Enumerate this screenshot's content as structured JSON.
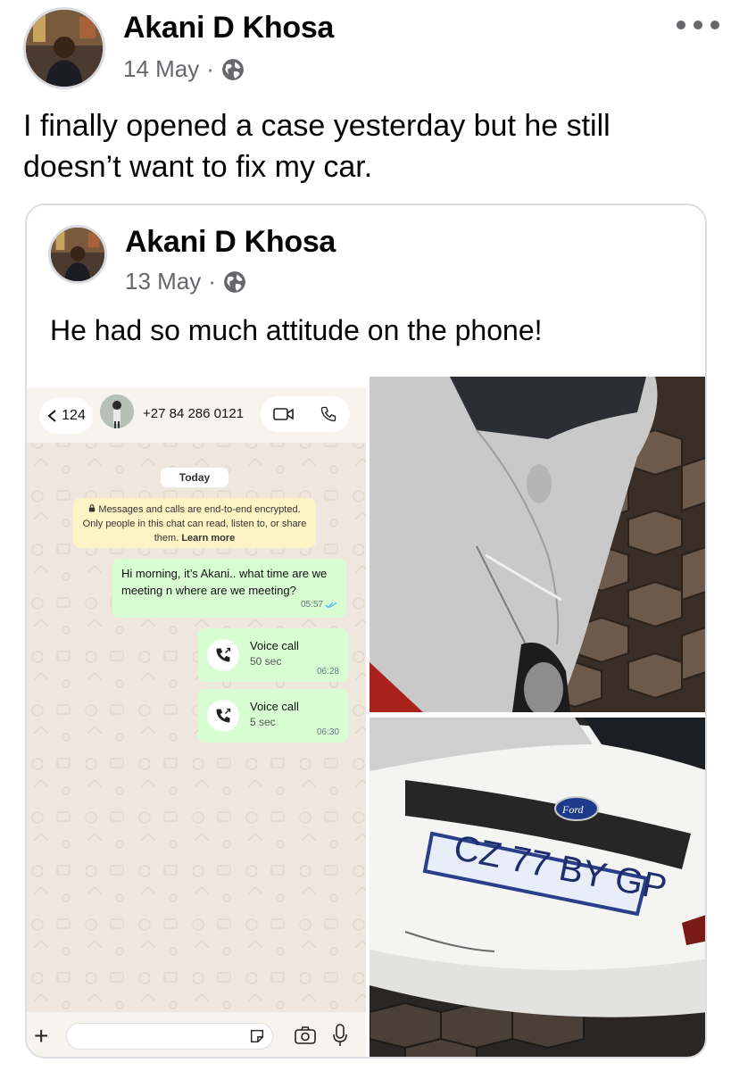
{
  "post": {
    "author": "Akani D Khosa",
    "date": "14 May",
    "separator": "·",
    "text": "I finally opened a case yesterday but he still doesn’t want to fix my car.",
    "privacy_icon": "globe-icon"
  },
  "shared": {
    "author": "Akani D Khosa",
    "date": "13 May",
    "separator": "·",
    "text": "He had so much attitude on the phone!",
    "privacy_icon": "globe-icon"
  },
  "whatsapp": {
    "back_count": "124",
    "contact": "+27 84 286 0121",
    "date_label": "Today",
    "encryption_text": "Messages and calls are end-to-end encrypted. Only people in this chat can read, listen to, or share them.",
    "encryption_link": "Learn more",
    "message": {
      "text": "Hi morning, it’s Akani.. what time are we meeting n where are we meeting?",
      "time": "05:57"
    },
    "calls": [
      {
        "title": "Voice call",
        "duration": "50 sec",
        "time": "06:28"
      },
      {
        "title": "Voice call",
        "duration": "5 sec",
        "time": "06:30"
      }
    ],
    "bg_color": "#efe7dd",
    "bubble_color": "#d9fdd3"
  },
  "photos": {
    "bottom_plate": "CZ 77 BY GP",
    "bottom_badge": "Ford"
  },
  "colors": {
    "text": "#050505",
    "meta": "#65676b",
    "border": "#dadde1"
  }
}
